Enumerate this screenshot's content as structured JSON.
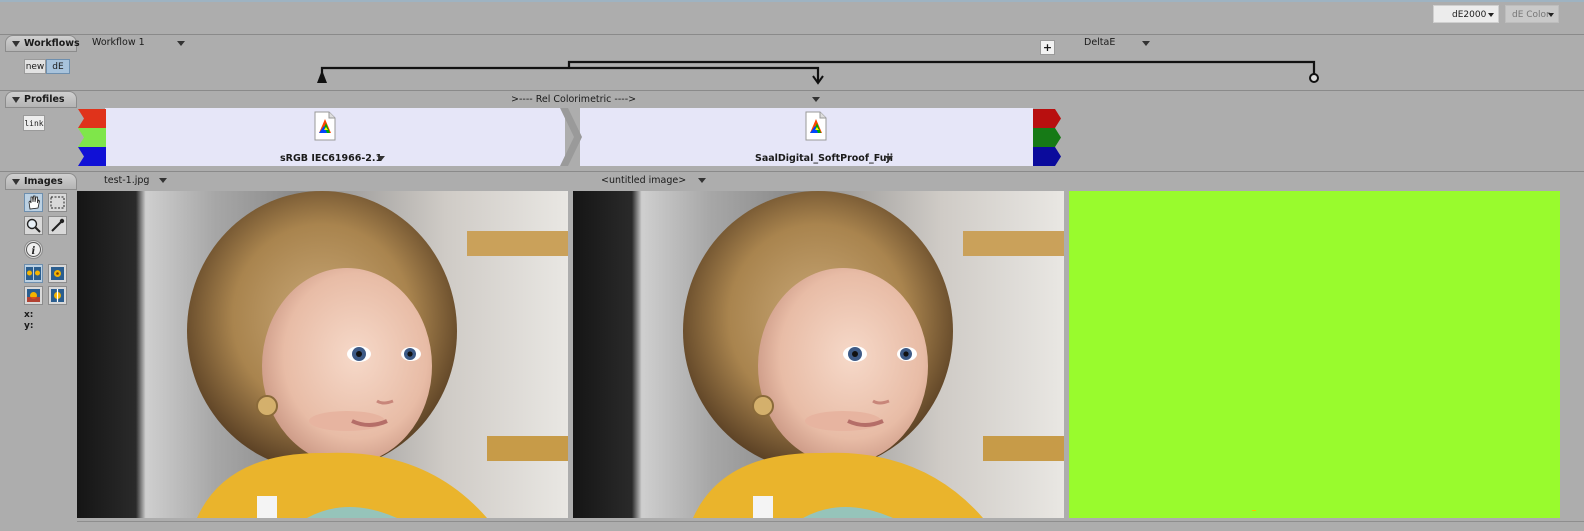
{
  "toolbar": {
    "metric_value": "dE2000",
    "mode_value": "dE Color"
  },
  "workflows": {
    "tab_label": "Workflows",
    "name": "Workflow 1",
    "new_label": "new",
    "de_label": "dE",
    "right_name": "DeltaE",
    "add_label": "+"
  },
  "profiles": {
    "tab_label": "Profiles",
    "link_label": "link",
    "intent": ">---- Rel Colorimetric ---->",
    "source_profile": "sRGB IEC61966-2.1",
    "target_profile": "SaalDigital_SoftProof_Fuji"
  },
  "images": {
    "tab_label": "Images",
    "left_name": "test-1.jpg",
    "middle_name": "<untitled image>",
    "x_label": "x:",
    "y_label": "y:",
    "diff_color": "#99fb2d"
  }
}
